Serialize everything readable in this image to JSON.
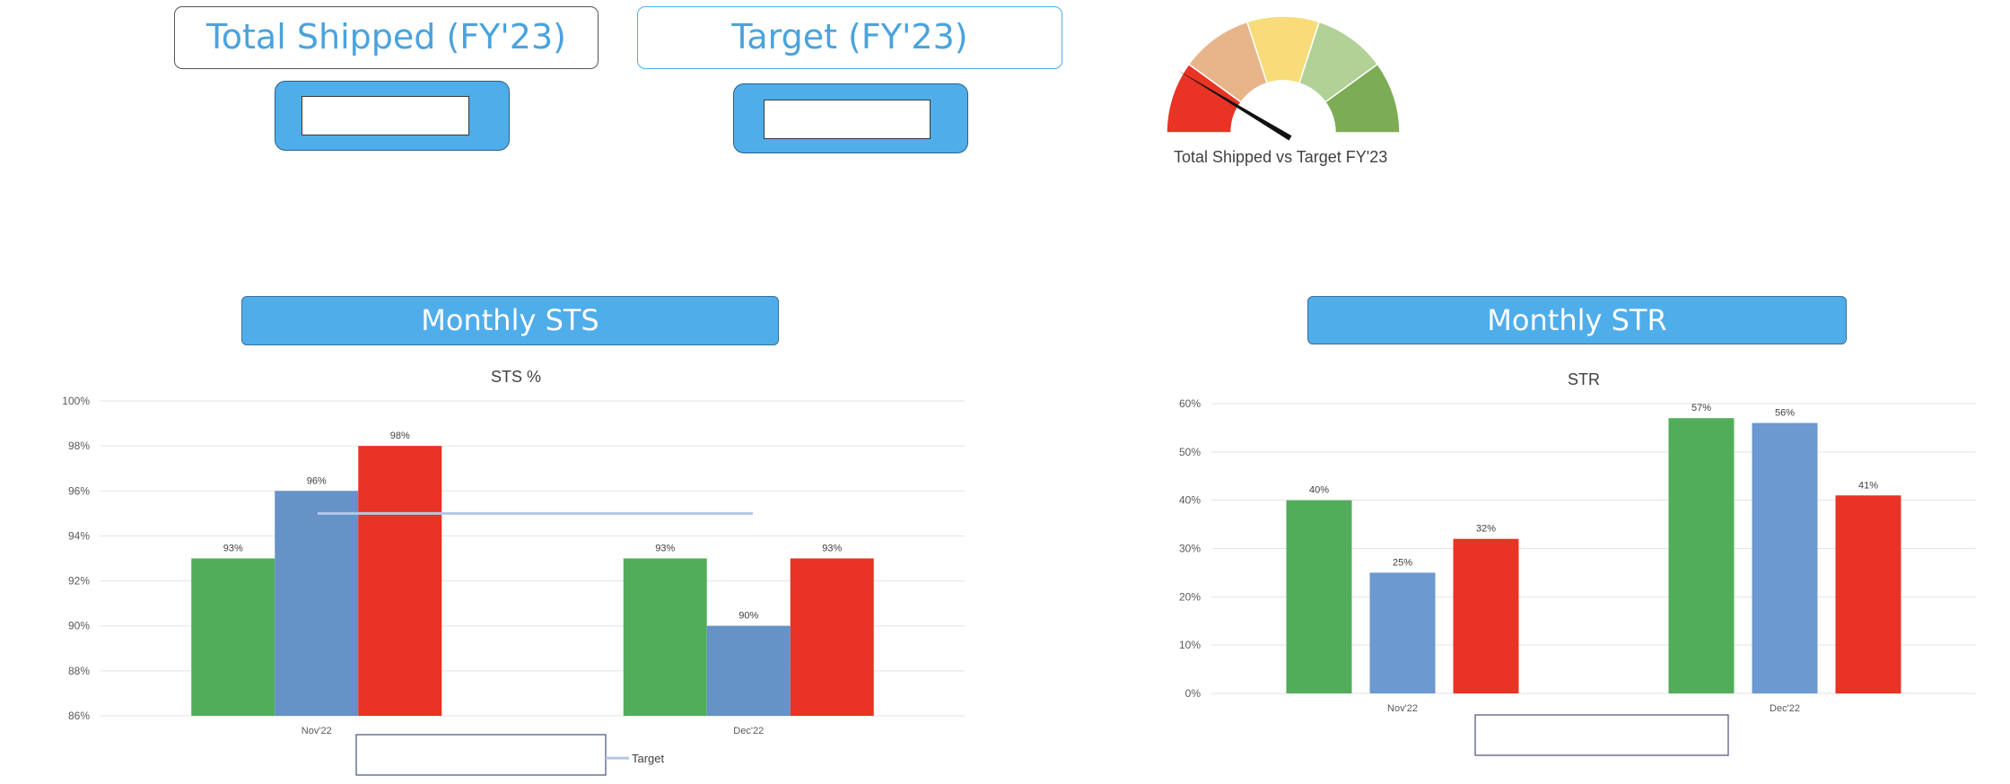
{
  "kpis": {
    "shipped_title": "Total Shipped (FY'23)",
    "target_title": "Target (FY'23)"
  },
  "gauge": {
    "caption": "Total Shipped vs Target FY'23",
    "segment_colors": [
      "#e93324",
      "#e8b48a",
      "#f7dc79",
      "#b1d196",
      "#7cac55"
    ]
  },
  "banners": {
    "sts": "Monthly STS",
    "str": "Monthly STR"
  },
  "chart_data": [
    {
      "type": "bar",
      "title": "STS %",
      "categories": [
        "Nov'22",
        "Dec'22"
      ],
      "series": [
        {
          "values": [
            93,
            93
          ],
          "color": "#52ad5b"
        },
        {
          "values": [
            96,
            90
          ],
          "color": "#6593c8"
        },
        {
          "values": [
            98,
            93
          ],
          "color": "#e93324"
        }
      ],
      "data_labels": [
        [
          "93%",
          "96%",
          "98%"
        ],
        [
          "93%",
          "90%",
          "93%"
        ]
      ],
      "target_line": {
        "name": "Target",
        "value": 95,
        "color": "#b4c6e7"
      },
      "ylim": [
        86,
        100
      ],
      "yticks": [
        86,
        88,
        90,
        92,
        94,
        96,
        98,
        100
      ],
      "ytick_labels": [
        "86%",
        "88%",
        "90%",
        "92%",
        "94%",
        "96%",
        "98%",
        "100%"
      ],
      "grid": true,
      "legend": [
        "Target"
      ]
    },
    {
      "type": "bar",
      "title": "STR",
      "categories": [
        "Nov'22",
        "Dec'22"
      ],
      "series": [
        {
          "values": [
            40,
            57
          ],
          "color": "#52ad5b"
        },
        {
          "values": [
            25,
            56
          ],
          "color": "#6b99d0"
        },
        {
          "values": [
            32,
            41
          ],
          "color": "#e93324"
        }
      ],
      "data_labels": [
        [
          "40%",
          "25%",
          "32%"
        ],
        [
          "57%",
          "56%",
          "41%"
        ]
      ],
      "ylim": [
        0,
        60
      ],
      "yticks": [
        0,
        10,
        20,
        30,
        40,
        50,
        60
      ],
      "ytick_labels": [
        "0%",
        "10%",
        "20%",
        "30%",
        "40%",
        "50%",
        "60%"
      ],
      "grid": true
    }
  ]
}
